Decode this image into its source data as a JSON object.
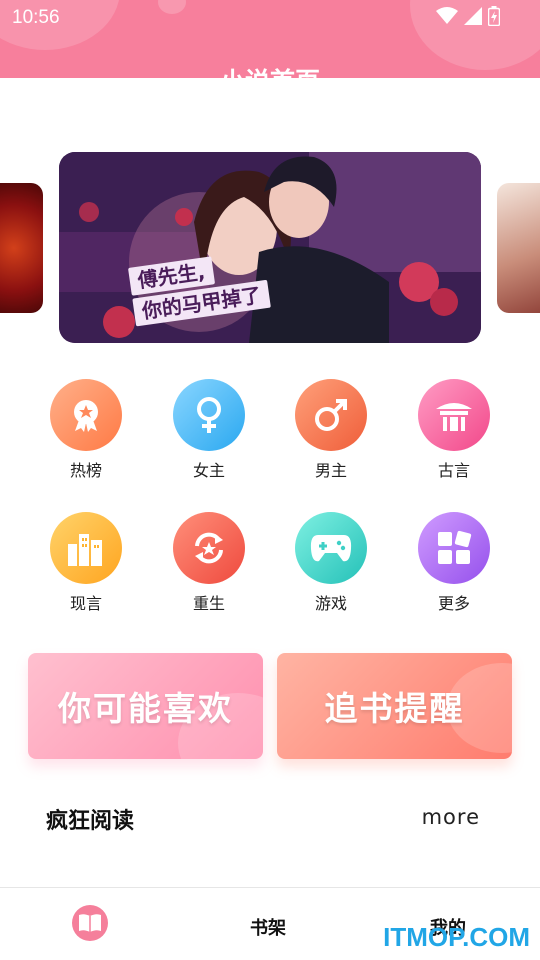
{
  "status_bar": {
    "time": "10:56"
  },
  "header": {
    "title": "小说首页"
  },
  "banner": {
    "line1": "傅先生,",
    "line2": "你的马甲掉了"
  },
  "categories": [
    {
      "label": "热榜",
      "icon": "award-icon",
      "color": "#ff8a5c"
    },
    {
      "label": "女主",
      "icon": "female-icon",
      "color": "#3fb4f5"
    },
    {
      "label": "男主",
      "icon": "male-icon",
      "color": "#f2714e"
    },
    {
      "label": "古言",
      "icon": "pavilion-icon",
      "color": "#f55f97"
    },
    {
      "label": "现言",
      "icon": "city-icon",
      "color": "#ffb431"
    },
    {
      "label": "重生",
      "icon": "rebirth-icon",
      "color": "#f5604f"
    },
    {
      "label": "游戏",
      "icon": "gamepad-icon",
      "color": "#3fd0c6"
    },
    {
      "label": "更多",
      "icon": "grid-icon",
      "color": "#a66bf0"
    }
  ],
  "promos": {
    "left": "你可能喜欢",
    "right": "追书提醒"
  },
  "section": {
    "title": "疯狂阅读",
    "more": "more"
  },
  "bottom_nav": {
    "home_icon": "book-icon",
    "shelf": "书架",
    "mine": "我的"
  },
  "watermark": "ITMOP.COM"
}
